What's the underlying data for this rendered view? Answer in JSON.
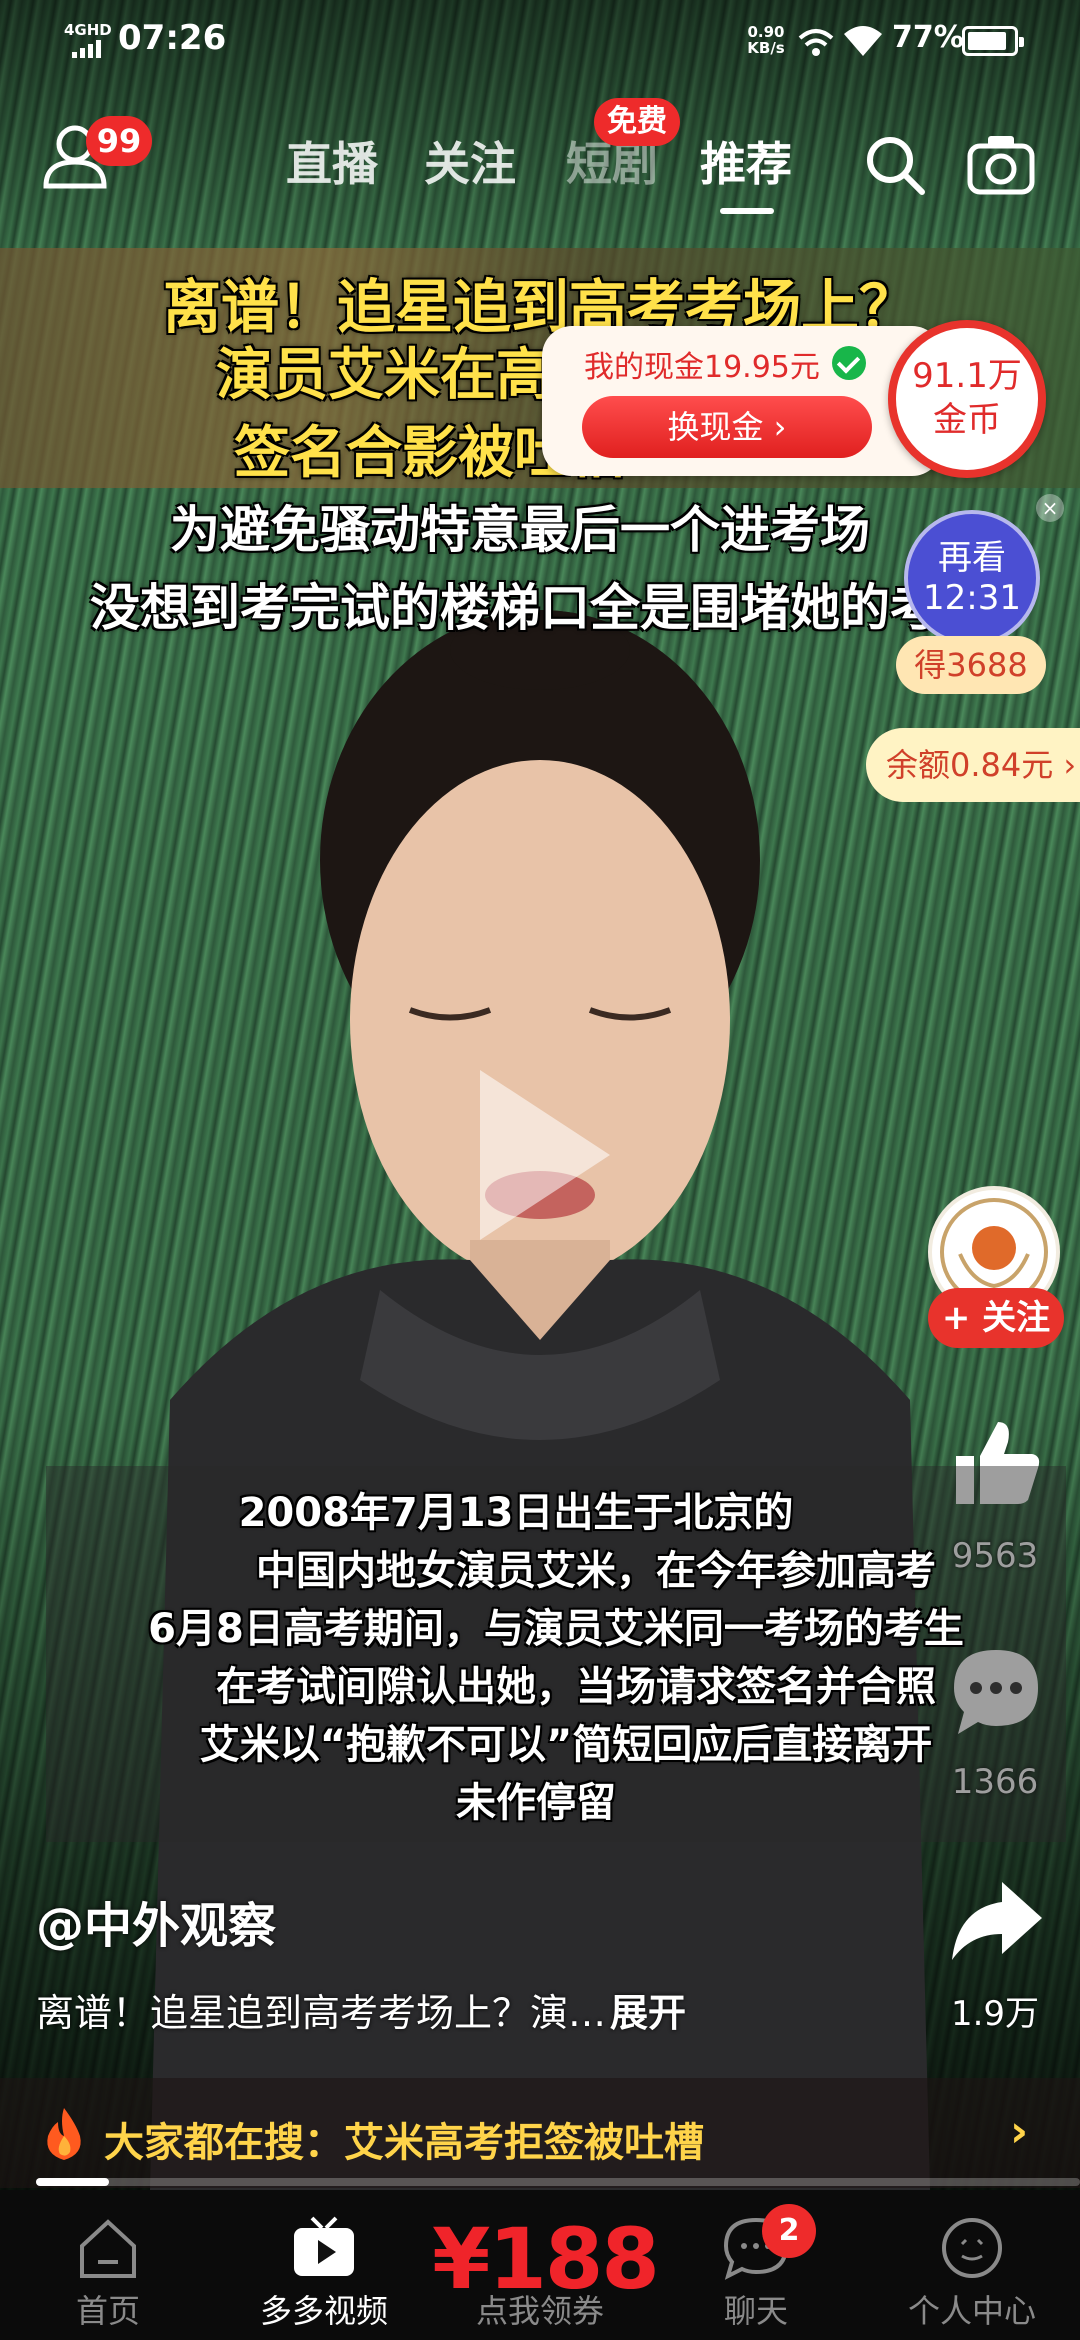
{
  "status_bar": {
    "network": "4GHD",
    "time": "07:26",
    "speed": "0.90 KB/s",
    "battery": "77%"
  },
  "top_nav": {
    "profile_badge": "99",
    "tabs": [
      {
        "label": "直播",
        "active": false
      },
      {
        "label": "关注",
        "active": false
      },
      {
        "label": "短剧",
        "active": false
      },
      {
        "label": "推荐",
        "active": true
      }
    ],
    "free_badge": "免费",
    "icons": [
      "search-icon",
      "camera-icon"
    ]
  },
  "video_overlay": {
    "headline_lines": [
      "离谱！追星追到高考考场上？",
      "演员艾米在高考考",
      "签名合影被吐槽"
    ],
    "subtitle_lines": [
      "为避免骚动特意最后一个进考场",
      "没想到考完试的楼梯口全是围堵她的考生"
    ],
    "caption_lines": [
      "2008年7月13日出生于北京的",
      "中国内地女演员艾米，在今年参加高考",
      "6月8日高考期间，与演员艾米同一考场的考生",
      "在考试间隙认出她，当场请求签名并合照",
      "艾米以“抱歉不可以”简短回应后直接离开",
      "未作停留"
    ]
  },
  "rewards": {
    "cash_label": "我的现金19.95元",
    "exchange_button": "换现金 ›",
    "coins_line1": "91.1万",
    "coins_line2": "金币",
    "replay_line1": "再看",
    "replay_line2": "12:31",
    "earn_label": "得3688",
    "balance_label": "余额0.84元 ›",
    "close_symbol": "×"
  },
  "actions": {
    "follow_button": "+ 关注",
    "like_count": "9563",
    "comment_count": "1366",
    "share_count": "1.9万"
  },
  "post": {
    "author": "@中外观察",
    "description": "离谱！追星追到高考考场上？演…",
    "expand_label": "展开"
  },
  "trending": {
    "text": "大家都在搜：艾米高考拒签被吐槽",
    "chevron": "›"
  },
  "playback": {
    "progress_fraction": 0.07
  },
  "bottom_tabs": [
    {
      "label": "首页",
      "icon": "home-icon",
      "active": false
    },
    {
      "label": "多多视频",
      "icon": "video-icon",
      "active": true
    },
    {
      "label": "点我领券",
      "price": "¥188",
      "active": false
    },
    {
      "label": "聊天",
      "icon": "chat-icon",
      "badge": "2",
      "active": false
    },
    {
      "label": "个人中心",
      "icon": "profile-icon",
      "active": false
    }
  ],
  "colors": {
    "accent_red": "#e8332c",
    "headline_yellow": "#ffe14a",
    "trend_yellow": "#ffd44a"
  }
}
